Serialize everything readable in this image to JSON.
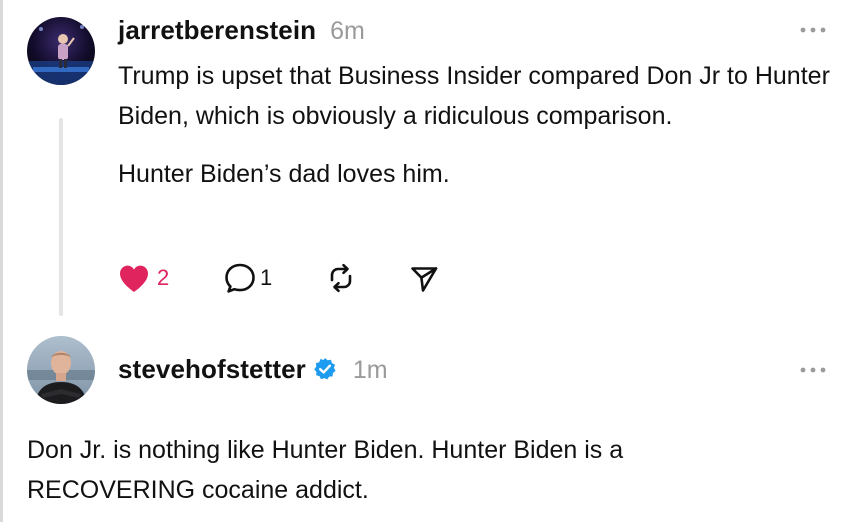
{
  "posts": [
    {
      "username": "jarretberenstein",
      "timestamp": "6m",
      "paragraphs": [
        "Trump is upset that Business Insider compared Don Jr to Hunter Biden, which is obviously a ridiculous comparison.",
        "Hunter Biden’s dad loves him."
      ],
      "likes": "2",
      "replies": "1",
      "liked": true
    },
    {
      "username": "stevehofstetter",
      "verified": true,
      "timestamp": "1m",
      "text": "Don Jr. is nothing like Hunter Biden. Hunter Biden is a RECOVERING cocaine addict."
    }
  ],
  "icons": {
    "like": "heart-icon",
    "reply": "comment-icon",
    "repost": "repost-icon",
    "share": "send-icon",
    "more": "more-icon",
    "verified": "verified-badge-icon"
  },
  "colors": {
    "like_active": "#e0245e",
    "verified": "#1d9bf0",
    "muted": "#9a9a9a",
    "thread_line": "#e5e5e5"
  }
}
